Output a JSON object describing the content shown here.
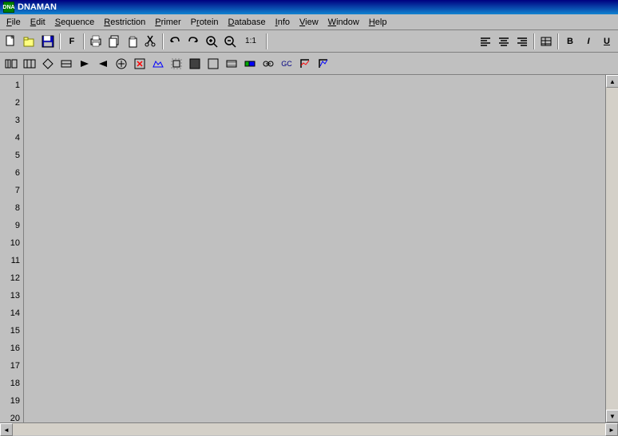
{
  "titlebar": {
    "icon_text": "DNA",
    "title": "DNAMAN"
  },
  "menubar": {
    "items": [
      {
        "label": "File",
        "underline_index": 0
      },
      {
        "label": "Edit",
        "underline_index": 0
      },
      {
        "label": "Sequence",
        "underline_index": 0
      },
      {
        "label": "Restriction",
        "underline_index": 0
      },
      {
        "label": "Primer",
        "underline_index": 0
      },
      {
        "label": "Protein",
        "underline_index": 0
      },
      {
        "label": "Database",
        "underline_index": 0
      },
      {
        "label": "Info",
        "underline_index": 0
      },
      {
        "label": "View",
        "underline_index": 0
      },
      {
        "label": "Window",
        "underline_index": 0
      },
      {
        "label": "Help",
        "underline_index": 0
      }
    ]
  },
  "toolbar1": {
    "buttons": [
      {
        "name": "new",
        "icon": "📄"
      },
      {
        "name": "open",
        "icon": "📂"
      },
      {
        "name": "save",
        "icon": "💾"
      },
      {
        "name": "sep1",
        "icon": ""
      },
      {
        "name": "font",
        "icon": "F"
      },
      {
        "name": "sep2",
        "icon": ""
      },
      {
        "name": "copy",
        "icon": ""
      },
      {
        "name": "paste",
        "icon": ""
      },
      {
        "name": "cut",
        "icon": "✂"
      },
      {
        "name": "sep3",
        "icon": ""
      },
      {
        "name": "undo",
        "icon": "↩"
      },
      {
        "name": "redo",
        "icon": "↪"
      },
      {
        "name": "zoom-in",
        "icon": "🔍"
      },
      {
        "name": "fit",
        "icon": "⊡"
      },
      {
        "name": "zoom-label",
        "icon": "1:1"
      }
    ],
    "right_buttons": [
      {
        "name": "align-left",
        "icon": "≡"
      },
      {
        "name": "align-center",
        "icon": "≡"
      },
      {
        "name": "align-right",
        "icon": "≡"
      },
      {
        "name": "sep4",
        "icon": ""
      },
      {
        "name": "list",
        "icon": "≡"
      },
      {
        "name": "sep5",
        "icon": ""
      },
      {
        "name": "bold",
        "icon": "B"
      },
      {
        "name": "italic",
        "icon": "I"
      },
      {
        "name": "underline",
        "icon": "U"
      }
    ]
  },
  "toolbar2": {
    "buttons": [
      {
        "name": "t1",
        "icon": "⊞"
      },
      {
        "name": "t2",
        "icon": "⊟"
      },
      {
        "name": "t3",
        "icon": "⊠"
      },
      {
        "name": "t4",
        "icon": "⊡"
      },
      {
        "name": "t5",
        "icon": "▶"
      },
      {
        "name": "t6",
        "icon": "◀"
      },
      {
        "name": "t7",
        "icon": "⊕"
      },
      {
        "name": "t8",
        "icon": "⊗"
      },
      {
        "name": "t9",
        "icon": "◈"
      },
      {
        "name": "t10",
        "icon": "⬚"
      },
      {
        "name": "t11",
        "icon": "⬛"
      },
      {
        "name": "t12",
        "icon": "⬜"
      },
      {
        "name": "t13",
        "icon": "◻"
      },
      {
        "name": "t14",
        "icon": "▣"
      },
      {
        "name": "t15",
        "icon": "⊞"
      },
      {
        "name": "t16",
        "icon": "⊟"
      },
      {
        "name": "t17",
        "icon": "⊠"
      },
      {
        "name": "t18",
        "icon": "⊡"
      }
    ]
  },
  "line_numbers": [
    1,
    2,
    3,
    4,
    5,
    6,
    7,
    8,
    9,
    10,
    11,
    12,
    13,
    14,
    15,
    16,
    17,
    18,
    19,
    20
  ],
  "colors": {
    "background": "#c0c0c0",
    "title_bar_start": "#000080",
    "title_bar_end": "#1084d0"
  }
}
